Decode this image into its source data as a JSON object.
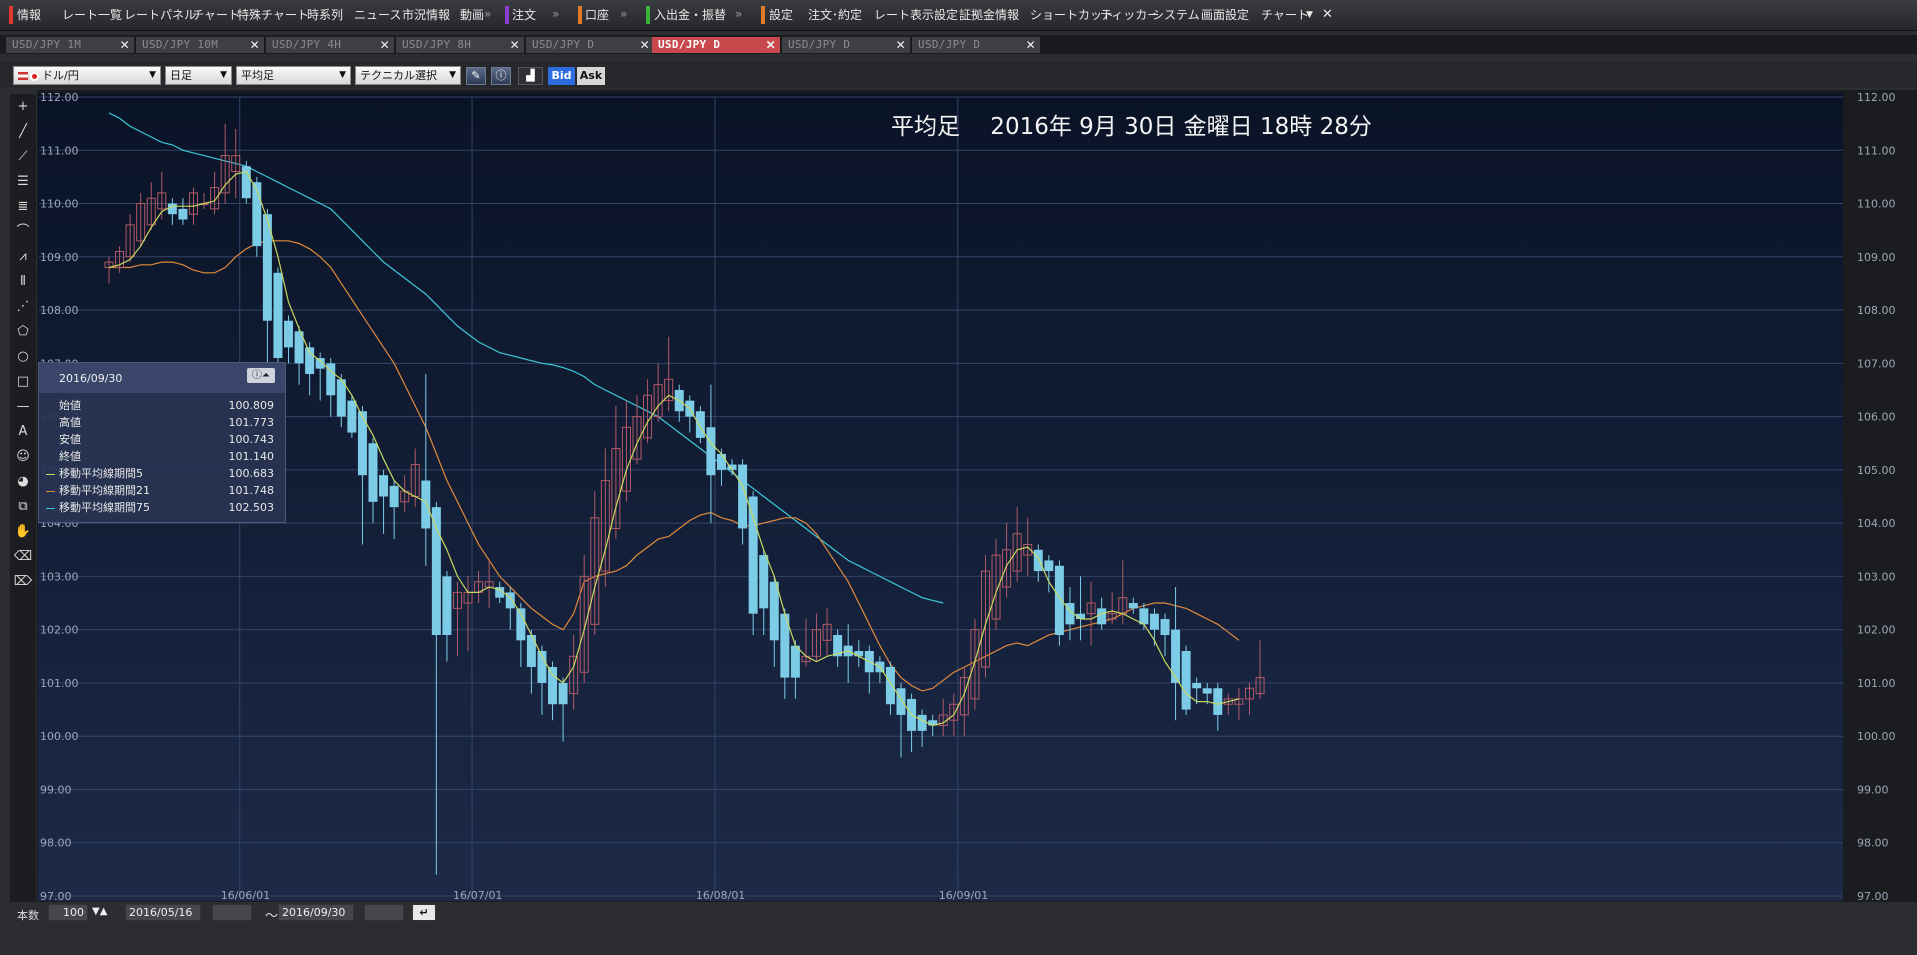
{
  "menu": {
    "items": [
      "情報",
      "レート一覧",
      "レートパネル",
      "チャート",
      "特殊チャート",
      "時系列",
      "ニュース",
      "市況情報",
      "動画",
      "注文",
      "口座",
      "入出金・振替",
      "設定",
      "注文･約定",
      "レート表示設定",
      "証拠金情報",
      "ショートカット",
      "ティッカー",
      "システム",
      "画面設定",
      "チャート"
    ],
    "group_colors": [
      "#e03a2e",
      "#8a3fd0",
      "#e07a28",
      "#38b43a",
      "#e07a28"
    ]
  },
  "tabs": [
    "USD/JPY 1M",
    "USD/JPY 10M",
    "USD/JPY 4H",
    "USD/JPY 8H",
    "USD/JPY D",
    "USD/JPY D",
    "USD/JPY D",
    "USD/JPY D"
  ],
  "active_tab": 5,
  "toolbar": {
    "symbol": "ドル/円",
    "period": "日足",
    "candle_type": "平均足",
    "technical": "テクニカル選択",
    "bid": "Bid",
    "ask": "Ask"
  },
  "overlay_title": "平均足　 2016年 9月 30日 金曜日 18時 28分",
  "data_window": {
    "date": "2016/09/30",
    "rows": [
      {
        "label": "始値",
        "value": "100.809",
        "color": ""
      },
      {
        "label": "高値",
        "value": "101.773",
        "color": ""
      },
      {
        "label": "安値",
        "value": "100.743",
        "color": ""
      },
      {
        "label": "終値",
        "value": "101.140",
        "color": ""
      },
      {
        "label": "移動平均線期間5",
        "value": "100.683",
        "color": "#c8d860"
      },
      {
        "label": "移動平均線期間21",
        "value": "101.748",
        "color": "#e08a3c"
      },
      {
        "label": "移動平均線期間75",
        "value": "102.503",
        "color": "#3cc8d8"
      }
    ]
  },
  "bottom": {
    "count_label": "本数",
    "count_value": "100",
    "from_date": "2016/05/16",
    "tilde": "～",
    "to_date": "2016/09/30"
  },
  "chart_data": {
    "type": "candlestick",
    "title": "平均足　 2016年 9月 30日 金曜日 18時 28分",
    "ylim": [
      97,
      112
    ],
    "y_ticks": [
      "112.00",
      "111.00",
      "110.00",
      "109.00",
      "108.00",
      "107.00",
      "106.00",
      "105.00",
      "104.00",
      "103.00",
      "102.00",
      "101.00",
      "100.00",
      "99.00",
      "98.00",
      "97.00"
    ],
    "x_ticks": [
      {
        "label": "16/06/01",
        "index": 12
      },
      {
        "label": "16/07/01",
        "index": 34
      },
      {
        "label": "16/08/01",
        "index": 57
      },
      {
        "label": "16/09/01",
        "index": 80
      }
    ],
    "grid": true,
    "colors": {
      "up": "#b05a66",
      "down": "#7ccce8",
      "ma5": "#c8d860",
      "ma21": "#e08a3c",
      "ma75": "#3cc8d8"
    },
    "candles": [
      {
        "o": 108.8,
        "h": 109.0,
        "l": 108.5,
        "c": 108.9
      },
      {
        "o": 108.8,
        "h": 109.2,
        "l": 108.7,
        "c": 109.1
      },
      {
        "o": 109.0,
        "h": 109.8,
        "l": 108.9,
        "c": 109.6
      },
      {
        "o": 109.3,
        "h": 110.2,
        "l": 109.2,
        "c": 110.0
      },
      {
        "o": 109.6,
        "h": 110.4,
        "l": 109.5,
        "c": 110.1
      },
      {
        "o": 109.9,
        "h": 110.6,
        "l": 109.7,
        "c": 110.2
      },
      {
        "o": 110.0,
        "h": 110.1,
        "l": 109.6,
        "c": 109.8
      },
      {
        "o": 109.9,
        "h": 110.1,
        "l": 109.6,
        "c": 109.7
      },
      {
        "o": 109.8,
        "h": 110.3,
        "l": 109.6,
        "c": 110.2
      },
      {
        "o": 110.0,
        "h": 110.2,
        "l": 109.9,
        "c": 110.0
      },
      {
        "o": 109.9,
        "h": 110.6,
        "l": 109.8,
        "c": 110.3
      },
      {
        "o": 110.2,
        "h": 111.5,
        "l": 110.0,
        "c": 110.9
      },
      {
        "o": 110.6,
        "h": 111.4,
        "l": 110.1,
        "c": 110.9
      },
      {
        "o": 110.7,
        "h": 110.8,
        "l": 110.0,
        "c": 110.1
      },
      {
        "o": 110.4,
        "h": 110.5,
        "l": 109.0,
        "c": 109.2
      },
      {
        "o": 109.8,
        "h": 109.9,
        "l": 106.5,
        "c": 107.8
      },
      {
        "o": 108.7,
        "h": 108.8,
        "l": 106.4,
        "c": 107.1
      },
      {
        "o": 107.8,
        "h": 107.9,
        "l": 107.0,
        "c": 107.3
      },
      {
        "o": 107.6,
        "h": 107.7,
        "l": 106.6,
        "c": 107.0
      },
      {
        "o": 107.3,
        "h": 107.4,
        "l": 106.4,
        "c": 106.8
      },
      {
        "o": 107.1,
        "h": 107.2,
        "l": 106.3,
        "c": 106.9
      },
      {
        "o": 107.0,
        "h": 107.1,
        "l": 106.0,
        "c": 106.4
      },
      {
        "o": 106.7,
        "h": 106.8,
        "l": 105.8,
        "c": 106.0
      },
      {
        "o": 106.3,
        "h": 106.4,
        "l": 105.6,
        "c": 105.7
      },
      {
        "o": 106.1,
        "h": 106.2,
        "l": 103.6,
        "c": 104.9
      },
      {
        "o": 105.5,
        "h": 105.6,
        "l": 104.0,
        "c": 104.4
      },
      {
        "o": 104.9,
        "h": 105.0,
        "l": 103.8,
        "c": 104.5
      },
      {
        "o": 104.7,
        "h": 104.8,
        "l": 103.7,
        "c": 104.3
      },
      {
        "o": 104.4,
        "h": 104.9,
        "l": 104.2,
        "c": 104.6
      },
      {
        "o": 104.5,
        "h": 105.4,
        "l": 104.3,
        "c": 105.1
      },
      {
        "o": 104.8,
        "h": 106.8,
        "l": 103.2,
        "c": 103.9
      },
      {
        "o": 104.3,
        "h": 104.4,
        "l": 97.4,
        "c": 101.9
      },
      {
        "o": 103.0,
        "h": 103.1,
        "l": 101.4,
        "c": 101.9
      },
      {
        "o": 102.4,
        "h": 102.9,
        "l": 101.5,
        "c": 102.7
      },
      {
        "o": 102.5,
        "h": 103.0,
        "l": 101.6,
        "c": 102.7
      },
      {
        "o": 102.7,
        "h": 103.1,
        "l": 102.5,
        "c": 102.9
      },
      {
        "o": 102.8,
        "h": 103.3,
        "l": 102.4,
        "c": 102.9
      },
      {
        "o": 102.8,
        "h": 102.9,
        "l": 102.5,
        "c": 102.6
      },
      {
        "o": 102.7,
        "h": 102.8,
        "l": 102.0,
        "c": 102.4
      },
      {
        "o": 102.4,
        "h": 102.5,
        "l": 101.3,
        "c": 101.8
      },
      {
        "o": 101.9,
        "h": 102.0,
        "l": 100.8,
        "c": 101.3
      },
      {
        "o": 101.6,
        "h": 101.7,
        "l": 100.4,
        "c": 101.0
      },
      {
        "o": 101.3,
        "h": 101.4,
        "l": 100.3,
        "c": 100.6
      },
      {
        "o": 101.0,
        "h": 101.1,
        "l": 99.9,
        "c": 100.6
      },
      {
        "o": 100.8,
        "h": 101.9,
        "l": 100.5,
        "c": 101.5
      },
      {
        "o": 101.2,
        "h": 103.4,
        "l": 101.0,
        "c": 103.0
      },
      {
        "o": 102.1,
        "h": 104.6,
        "l": 101.9,
        "c": 104.1
      },
      {
        "o": 103.1,
        "h": 105.4,
        "l": 102.8,
        "c": 104.8
      },
      {
        "o": 103.9,
        "h": 106.2,
        "l": 103.7,
        "c": 105.4
      },
      {
        "o": 104.6,
        "h": 106.3,
        "l": 104.4,
        "c": 105.8
      },
      {
        "o": 105.2,
        "h": 106.4,
        "l": 105.1,
        "c": 106.0
      },
      {
        "o": 105.6,
        "h": 106.7,
        "l": 105.5,
        "c": 106.4
      },
      {
        "o": 106.0,
        "h": 107.0,
        "l": 105.9,
        "c": 106.6
      },
      {
        "o": 106.3,
        "h": 107.5,
        "l": 106.1,
        "c": 106.7
      },
      {
        "o": 106.5,
        "h": 106.6,
        "l": 105.9,
        "c": 106.1
      },
      {
        "o": 106.3,
        "h": 106.4,
        "l": 105.7,
        "c": 106.0
      },
      {
        "o": 106.1,
        "h": 106.2,
        "l": 105.5,
        "c": 105.6
      },
      {
        "o": 105.8,
        "h": 106.6,
        "l": 104.0,
        "c": 104.9
      },
      {
        "o": 105.3,
        "h": 105.4,
        "l": 104.7,
        "c": 105.0
      },
      {
        "o": 105.1,
        "h": 105.2,
        "l": 104.9,
        "c": 105.0
      },
      {
        "o": 105.1,
        "h": 105.2,
        "l": 103.6,
        "c": 103.9
      },
      {
        "o": 104.5,
        "h": 104.6,
        "l": 101.9,
        "c": 102.3
      },
      {
        "o": 103.4,
        "h": 103.5,
        "l": 101.9,
        "c": 102.4
      },
      {
        "o": 102.9,
        "h": 103.0,
        "l": 101.3,
        "c": 101.8
      },
      {
        "o": 102.3,
        "h": 102.4,
        "l": 100.7,
        "c": 101.1
      },
      {
        "o": 101.7,
        "h": 101.8,
        "l": 100.7,
        "c": 101.1
      },
      {
        "o": 101.4,
        "h": 102.2,
        "l": 101.3,
        "c": 101.5
      },
      {
        "o": 101.5,
        "h": 102.3,
        "l": 101.4,
        "c": 102.0
      },
      {
        "o": 101.8,
        "h": 102.4,
        "l": 101.5,
        "c": 102.1
      },
      {
        "o": 101.9,
        "h": 102.0,
        "l": 101.3,
        "c": 101.5
      },
      {
        "o": 101.7,
        "h": 102.1,
        "l": 101.0,
        "c": 101.5
      },
      {
        "o": 101.6,
        "h": 101.8,
        "l": 101.3,
        "c": 101.5
      },
      {
        "o": 101.6,
        "h": 101.7,
        "l": 100.8,
        "c": 101.2
      },
      {
        "o": 101.4,
        "h": 101.5,
        "l": 101.0,
        "c": 101.2
      },
      {
        "o": 101.3,
        "h": 101.4,
        "l": 100.4,
        "c": 100.6
      },
      {
        "o": 100.9,
        "h": 101.0,
        "l": 99.6,
        "c": 100.4
      },
      {
        "o": 100.7,
        "h": 100.8,
        "l": 99.7,
        "c": 100.1
      },
      {
        "o": 100.4,
        "h": 100.5,
        "l": 99.8,
        "c": 100.1
      },
      {
        "o": 100.3,
        "h": 100.4,
        "l": 100.0,
        "c": 100.2
      },
      {
        "o": 100.2,
        "h": 100.7,
        "l": 100.0,
        "c": 100.4
      },
      {
        "o": 100.3,
        "h": 100.8,
        "l": 100.0,
        "c": 100.6
      },
      {
        "o": 100.4,
        "h": 101.3,
        "l": 100.0,
        "c": 101.1
      },
      {
        "o": 100.7,
        "h": 102.2,
        "l": 100.5,
        "c": 102.0
      },
      {
        "o": 101.3,
        "h": 103.4,
        "l": 101.1,
        "c": 103.1
      },
      {
        "o": 102.2,
        "h": 103.7,
        "l": 102.0,
        "c": 103.4
      },
      {
        "o": 102.8,
        "h": 104.0,
        "l": 102.6,
        "c": 103.5
      },
      {
        "o": 103.1,
        "h": 104.3,
        "l": 102.9,
        "c": 103.8
      },
      {
        "o": 103.4,
        "h": 104.1,
        "l": 103.0,
        "c": 103.6
      },
      {
        "o": 103.5,
        "h": 103.6,
        "l": 102.9,
        "c": 103.1
      },
      {
        "o": 103.3,
        "h": 103.4,
        "l": 102.7,
        "c": 103.1
      },
      {
        "o": 103.2,
        "h": 103.3,
        "l": 101.7,
        "c": 101.9
      },
      {
        "o": 102.5,
        "h": 102.8,
        "l": 101.8,
        "c": 102.1
      },
      {
        "o": 102.3,
        "h": 103.0,
        "l": 101.8,
        "c": 102.2
      },
      {
        "o": 102.3,
        "h": 102.9,
        "l": 101.7,
        "c": 102.5
      },
      {
        "o": 102.4,
        "h": 102.6,
        "l": 102.0,
        "c": 102.1
      },
      {
        "o": 102.2,
        "h": 102.7,
        "l": 102.1,
        "c": 102.3
      },
      {
        "o": 102.3,
        "h": 103.3,
        "l": 102.1,
        "c": 102.6
      },
      {
        "o": 102.5,
        "h": 102.6,
        "l": 102.3,
        "c": 102.4
      },
      {
        "o": 102.4,
        "h": 102.5,
        "l": 102.0,
        "c": 102.1
      },
      {
        "o": 102.3,
        "h": 102.4,
        "l": 101.7,
        "c": 102.0
      },
      {
        "o": 102.2,
        "h": 102.3,
        "l": 101.5,
        "c": 101.9
      },
      {
        "o": 102.0,
        "h": 102.8,
        "l": 100.3,
        "c": 101.0
      },
      {
        "o": 101.6,
        "h": 101.7,
        "l": 100.4,
        "c": 100.5
      },
      {
        "o": 101.0,
        "h": 101.1,
        "l": 100.6,
        "c": 100.9
      },
      {
        "o": 100.9,
        "h": 101.0,
        "l": 100.6,
        "c": 100.8
      },
      {
        "o": 100.9,
        "h": 101.0,
        "l": 100.1,
        "c": 100.4
      },
      {
        "o": 100.6,
        "h": 100.8,
        "l": 100.4,
        "c": 100.7
      },
      {
        "o": 100.6,
        "h": 100.9,
        "l": 100.3,
        "c": 100.7
      },
      {
        "o": 100.7,
        "h": 101.0,
        "l": 100.4,
        "c": 100.9
      },
      {
        "o": 100.8,
        "h": 101.8,
        "l": 100.7,
        "c": 101.1
      }
    ],
    "ma5": [
      108.8,
      108.85,
      108.95,
      109.2,
      109.55,
      109.85,
      109.95,
      109.95,
      109.95,
      110.0,
      110.05,
      110.35,
      110.55,
      110.6,
      110.25,
      109.7,
      109.0,
      108.15,
      107.65,
      107.2,
      107.05,
      106.85,
      106.7,
      106.4,
      106.0,
      105.65,
      105.2,
      104.8,
      104.6,
      104.5,
      104.4,
      103.9,
      103.5,
      103.0,
      102.7,
      102.7,
      102.8,
      102.75,
      102.6,
      102.3,
      101.9,
      101.5,
      101.15,
      101.0,
      101.3,
      102.0,
      102.8,
      103.5,
      104.3,
      105.0,
      105.5,
      105.9,
      106.2,
      106.4,
      106.3,
      106.15,
      105.8,
      105.5,
      105.3,
      105.0,
      104.7,
      104.1,
      103.5,
      103.0,
      102.3,
      101.7,
      101.5,
      101.4,
      101.5,
      101.55,
      101.6,
      101.5,
      101.4,
      101.3,
      101.0,
      100.7,
      100.4,
      100.3,
      100.2,
      100.25,
      100.4,
      100.8,
      101.4,
      102.1,
      102.7,
      103.2,
      103.5,
      103.55,
      103.35,
      102.9,
      102.6,
      102.35,
      102.2,
      102.2,
      102.3,
      102.35,
      102.3,
      102.2,
      102.1,
      101.8,
      101.4,
      101.1,
      100.8,
      100.65,
      100.65,
      100.6,
      100.65,
      100.7
    ],
    "ma21": [
      108.8,
      108.8,
      108.8,
      108.85,
      108.85,
      108.9,
      108.9,
      108.85,
      108.75,
      108.7,
      108.7,
      108.8,
      109.0,
      109.15,
      109.25,
      109.3,
      109.3,
      109.3,
      109.25,
      109.15,
      109.0,
      108.8,
      108.5,
      108.2,
      107.9,
      107.6,
      107.3,
      107.0,
      106.6,
      106.2,
      105.8,
      105.3,
      104.8,
      104.4,
      104.0,
      103.6,
      103.3,
      103.0,
      102.8,
      102.6,
      102.4,
      102.25,
      102.1,
      102.0,
      102.3,
      102.9,
      103.0,
      103.05,
      103.1,
      103.2,
      103.4,
      103.55,
      103.7,
      103.75,
      103.9,
      104.05,
      104.15,
      104.2,
      104.1,
      104.05,
      103.95,
      103.95,
      104.0,
      104.05,
      104.1,
      104.1,
      104.0,
      103.8,
      103.5,
      103.2,
      102.9,
      102.5,
      102.1,
      101.7,
      101.35,
      101.1,
      100.95,
      100.85,
      100.9,
      101.05,
      101.2,
      101.3,
      101.4,
      101.5,
      101.6,
      101.7,
      101.75,
      101.7,
      101.8,
      101.9,
      101.95,
      102.0,
      102.05,
      102.1,
      102.15,
      102.2,
      102.3,
      102.4,
      102.45,
      102.5,
      102.5,
      102.45,
      102.4,
      102.3,
      102.2,
      102.1,
      101.95,
      101.8
    ],
    "ma75": [
      111.7,
      111.6,
      111.45,
      111.35,
      111.25,
      111.15,
      111.1,
      111.0,
      110.95,
      110.9,
      110.85,
      110.8,
      110.75,
      110.7,
      110.6,
      110.5,
      110.4,
      110.3,
      110.2,
      110.1,
      110.0,
      109.9,
      109.7,
      109.5,
      109.3,
      109.1,
      108.9,
      108.75,
      108.6,
      108.45,
      108.3,
      108.1,
      107.9,
      107.7,
      107.55,
      107.4,
      107.3,
      107.2,
      107.15,
      107.1,
      107.05,
      107.0,
      106.97,
      106.92,
      106.85,
      106.75,
      106.6,
      106.5,
      106.4,
      106.3,
      106.2,
      106.1,
      106.0,
      105.85,
      105.7,
      105.55,
      105.4,
      105.25,
      105.1,
      104.95,
      104.8,
      104.65,
      104.5,
      104.35,
      104.2,
      104.05,
      103.9,
      103.75,
      103.6,
      103.45,
      103.3,
      103.2,
      103.1,
      103.0,
      102.9,
      102.8,
      102.7,
      102.6,
      102.55,
      102.5
    ]
  }
}
